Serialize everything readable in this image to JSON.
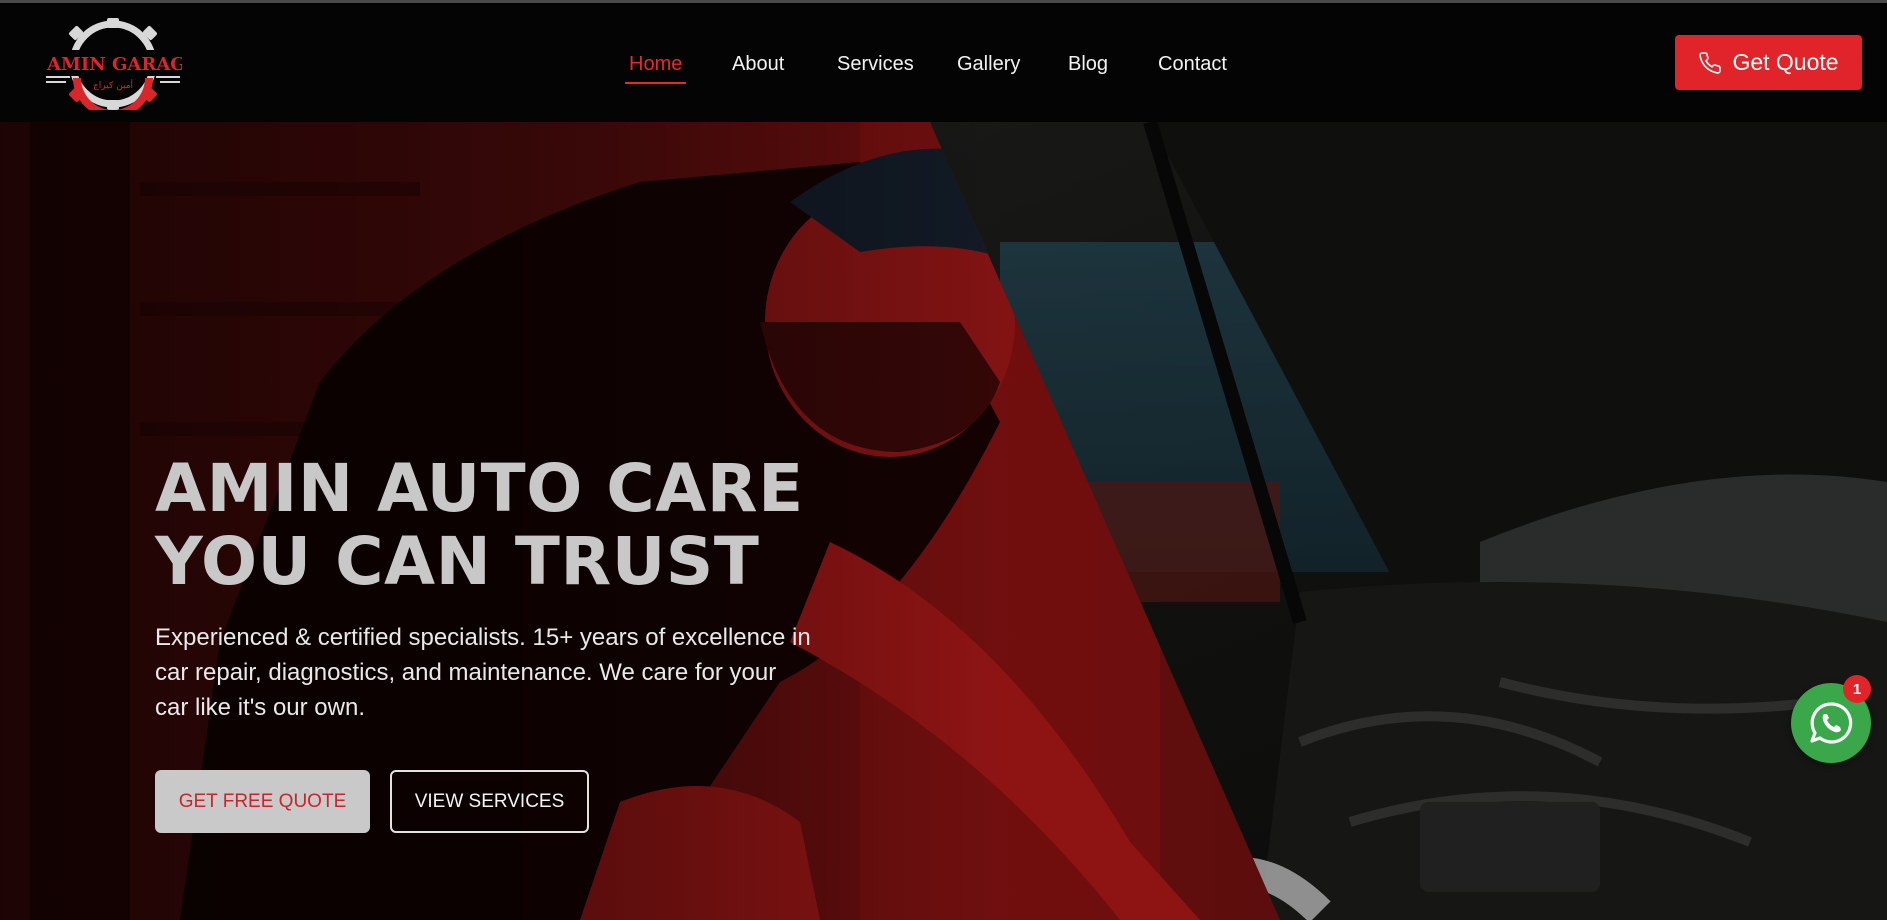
{
  "brand": {
    "logo_text": "AMIN GARAGE",
    "logo_subtext": "أمين كيراج",
    "accent_color": "#e0242a"
  },
  "nav": {
    "items": [
      {
        "label": "Home",
        "active": true
      },
      {
        "label": "About",
        "active": false
      },
      {
        "label": "Services",
        "active": false
      },
      {
        "label": "Gallery",
        "active": false
      },
      {
        "label": "Blog",
        "active": false
      },
      {
        "label": "Contact",
        "active": false
      }
    ],
    "cta_label": "Get Quote",
    "cta_icon": "phone-icon"
  },
  "hero": {
    "title_line1": "AMIN AUTO CARE",
    "title_line2": "YOU CAN TRUST",
    "description": "Experienced & certified specialists. 15+ years of excellence in car repair, diagnostics, and maintenance. We care for your car like it's our own.",
    "primary_button": "GET FREE QUOTE",
    "secondary_button": "VIEW SERVICES"
  },
  "whatsapp": {
    "icon": "whatsapp-icon",
    "badge_count": "1",
    "color": "#3aa84a"
  }
}
